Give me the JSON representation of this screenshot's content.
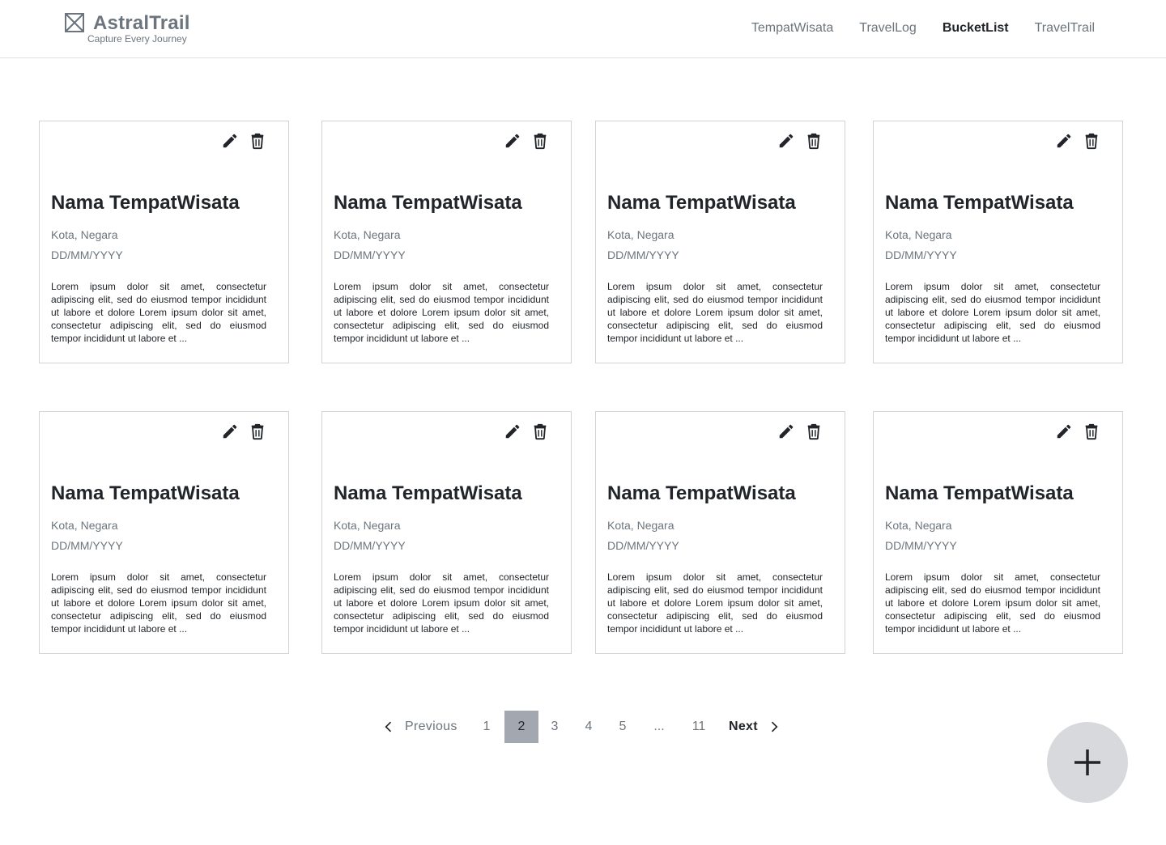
{
  "header": {
    "brand_name": "AstralTrail",
    "brand_tagline": "Capture Every Journey",
    "nav": [
      {
        "label": "TempatWisata",
        "active": false
      },
      {
        "label": "TravelLog",
        "active": false
      },
      {
        "label": "BucketList",
        "active": true
      },
      {
        "label": "TravelTrail",
        "active": false
      }
    ]
  },
  "cards": [
    {
      "title": "Nama TempatWisata",
      "location": "Kota, Negara",
      "date": "DD/MM/YYYY",
      "description": "Lorem ipsum dolor sit amet, consectetur adipiscing elit, sed do eiusmod tempor incididunt ut labore et dolore Lorem ipsum dolor sit amet, consectetur adipiscing elit, sed do eiusmod tempor incididunt ut labore et ..."
    },
    {
      "title": "Nama TempatWisata",
      "location": "Kota, Negara",
      "date": "DD/MM/YYYY",
      "description": "Lorem ipsum dolor sit amet, consectetur adipiscing elit, sed do eiusmod tempor incididunt ut labore et dolore Lorem ipsum dolor sit amet, consectetur adipiscing elit, sed do eiusmod tempor incididunt ut labore et ..."
    },
    {
      "title": "Nama TempatWisata",
      "location": "Kota, Negara",
      "date": "DD/MM/YYYY",
      "description": "Lorem ipsum dolor sit amet, consectetur adipiscing elit, sed do eiusmod tempor incididunt ut labore et dolore Lorem ipsum dolor sit amet, consectetur adipiscing elit, sed do eiusmod tempor incididunt ut labore et ..."
    },
    {
      "title": "Nama TempatWisata",
      "location": "Kota, Negara",
      "date": "DD/MM/YYYY",
      "description": "Lorem ipsum dolor sit amet, consectetur adipiscing elit, sed do eiusmod tempor incididunt ut labore et dolore Lorem ipsum dolor sit amet, consectetur adipiscing elit, sed do eiusmod tempor incididunt ut labore et ..."
    },
    {
      "title": "Nama TempatWisata",
      "location": "Kota, Negara",
      "date": "DD/MM/YYYY",
      "description": "Lorem ipsum dolor sit amet, consectetur adipiscing elit, sed do eiusmod tempor incididunt ut labore et dolore Lorem ipsum dolor sit amet, consectetur adipiscing elit, sed do eiusmod tempor incididunt ut labore et ..."
    },
    {
      "title": "Nama TempatWisata",
      "location": "Kota, Negara",
      "date": "DD/MM/YYYY",
      "description": "Lorem ipsum dolor sit amet, consectetur adipiscing elit, sed do eiusmod tempor incididunt ut labore et dolore Lorem ipsum dolor sit amet, consectetur adipiscing elit, sed do eiusmod tempor incididunt ut labore et ..."
    },
    {
      "title": "Nama TempatWisata",
      "location": "Kota, Negara",
      "date": "DD/MM/YYYY",
      "description": "Lorem ipsum dolor sit amet, consectetur adipiscing elit, sed do eiusmod tempor incididunt ut labore et dolore Lorem ipsum dolor sit amet, consectetur adipiscing elit, sed do eiusmod tempor incididunt ut labore et ..."
    },
    {
      "title": "Nama TempatWisata",
      "location": "Kota, Negara",
      "date": "DD/MM/YYYY",
      "description": "Lorem ipsum dolor sit amet, consectetur adipiscing elit, sed do eiusmod tempor incididunt ut labore et dolore Lorem ipsum dolor sit amet, consectetur adipiscing elit, sed do eiusmod tempor incididunt ut labore et ..."
    }
  ],
  "card_icons": {
    "edit": "pencil-icon",
    "delete": "trash-icon"
  },
  "pagination": {
    "previous_label": "Previous",
    "next_label": "Next",
    "pages": [
      "1",
      "2",
      "3",
      "4",
      "5",
      "...",
      "11"
    ],
    "current_page": "2"
  },
  "fab": {
    "icon": "plus-icon"
  }
}
